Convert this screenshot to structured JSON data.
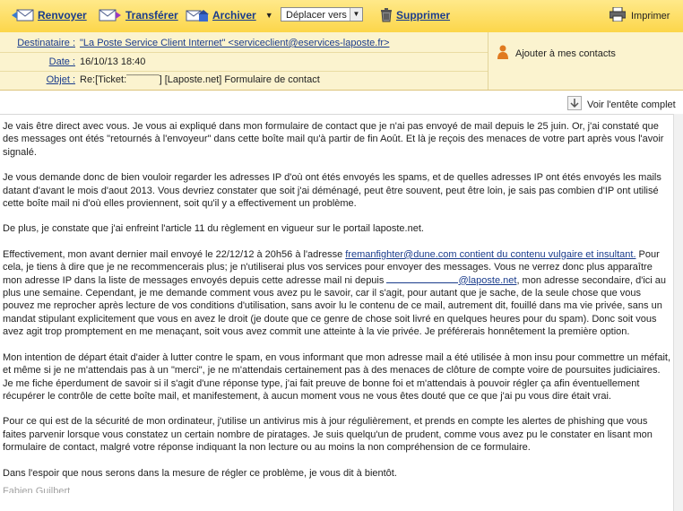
{
  "toolbar": {
    "reply_label": "Renvoyer",
    "forward_label": "Transférer",
    "archive_label": "Archiver",
    "move_select": "Déplacer vers",
    "delete_label": "Supprimer",
    "print_label": "Imprimer"
  },
  "header": {
    "to_label": "Destinataire :",
    "to_value": "\"La Poste Service Client Internet\" <serviceclient@eservices-laposte.fr>",
    "date_label": "Date :",
    "date_value": "16/10/13 18:40",
    "subject_label": "Objet :",
    "subject_value": "Re:[Ticket:¯¯¯¯¯¯] [Laposte.net] Formulaire de contact",
    "add_contact_label": "Ajouter à mes contacts",
    "show_headers_label": "Voir l'entête complet"
  },
  "body": {
    "p1": "Je vais être direct avec vous. Je vous ai expliqué dans mon formulaire de contact que je n'ai pas envoyé de mail depuis le 25 juin. Or, j'ai constaté que des messages ont étés \"retournés à l'envoyeur\" dans cette boîte mail qu'à partir de fin Août. Et là je reçois des menaces de votre part après vous l'avoir signalé.",
    "p2": "Je vous demande donc de bien vouloir regarder les adresses IP d'où ont étés envoyés les spams, et de quelles adresses IP ont étés envoyés les mails datant d'avant le mois d'aout 2013. Vous devriez constater que soit j'ai déménagé, peut être souvent, peut être loin, je sais pas combien d'IP ont utilisé cette boîte mail ni d'où elles proviennent, soit qu'il y a effectivement un problème.",
    "p3": "De plus, je constate que j'ai enfreint l'article 11 du règlement en vigueur sur le portail laposte.net.",
    "p4a": "Effectivement, mon avant dernier mail envoyé le 22/12/12 à 20h56 à l'adresse ",
    "p4_link": "fremanfighter@dune.com contient du contenu vulgaire et insultant.",
    "p4b": " Pour cela, je tiens à dire que je ne recommencerais plus; je n'utiliserai plus vos services pour envoyer des messages. Vous ne verrez donc plus apparaître mon adresse IP dans la liste de messages envoyés depuis cette adresse mail ni depuis ",
    "p4_link2": "@laposte.net",
    "p4c": ", mon adresse secondaire, d'ici au plus une semaine. Cependant, je me demande comment vous avez pu le savoir, car il s'agit, pour autant que je sache, de la seule chose que vous pouvez me reprocher après lecture de vos conditions d'utilisation, sans avoir lu le contenu de ce mail, autrement dit, fouillé dans ma vie privée, sans un mandat stipulant explicitement que vous en avez le droit (je doute que ce genre de chose soit livré en quelques heures pour du spam). Donc soit vous avez agit trop promptement en me menaçant, soit vous avez commit une atteinte à la vie privée. Je préférerais honnêtement la première option.",
    "p5": "Mon intention de départ était d'aider à lutter contre le spam, en vous informant que mon adresse mail a été utilisée à mon insu pour commettre un méfait, et même si je ne m'attendais pas à un \"merci\", je ne m'attendais certainement pas à des menaces de clôture de compte voire de poursuites judiciaires. Je me fiche éperdument de savoir si il s'agit d'une réponse type, j'ai fait preuve de bonne foi et m'attendais à pouvoir régler ça afin éventuellement récupérer le contrôle de cette boîte mail, et manifestement, à aucun moment vous ne vous êtes douté que ce que j'ai pu vous dire était vrai.",
    "p6": "Pour ce qui est de la sécurité de mon ordinateur, j'utilise un antivirus mis à jour régulièrement, et prends en compte les alertes de phishing que vous faites parvenir lorsque vous constatez un certain nombre de piratages. Je suis quelqu'un de prudent, comme vous avez pu le constater en lisant mon formulaire de contact, malgré votre réponse indiquant la non lecture ou au moins la non compréhension de ce formulaire.",
    "p7": "Dans l'espoir que nous serons dans la mesure de régler ce problème, je vous dit à bientôt.",
    "cutoff": "Fabien Guilbert"
  },
  "colors": {
    "toolbar_bg": "#fcd64a",
    "header_bg": "#fbf3cf",
    "link": "#1a3c8c"
  }
}
